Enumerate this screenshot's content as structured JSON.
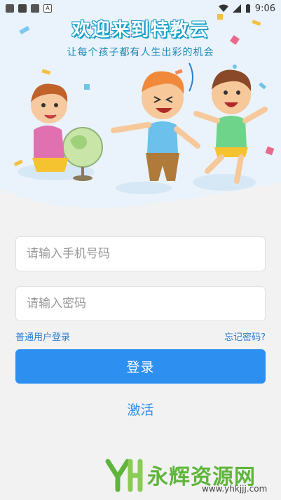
{
  "status": {
    "time": "9:06"
  },
  "hero": {
    "title": "欢迎来到特教云",
    "subtitle": "让每个孩子都有人生出彩的机会"
  },
  "form": {
    "phone_placeholder": "请输入手机号码",
    "password_placeholder": "请输入密码",
    "user_login_link": "普通用户登录",
    "forgot_link": "忘记密码?",
    "login_label": "登录",
    "activate_label": "激活"
  },
  "watermark": {
    "name": "永辉资源网",
    "url": "www.yhkjjj.com"
  },
  "colors": {
    "accent": "#2d8ff0",
    "link": "#2a7fd4",
    "watermark_green": "#5fb53b"
  }
}
